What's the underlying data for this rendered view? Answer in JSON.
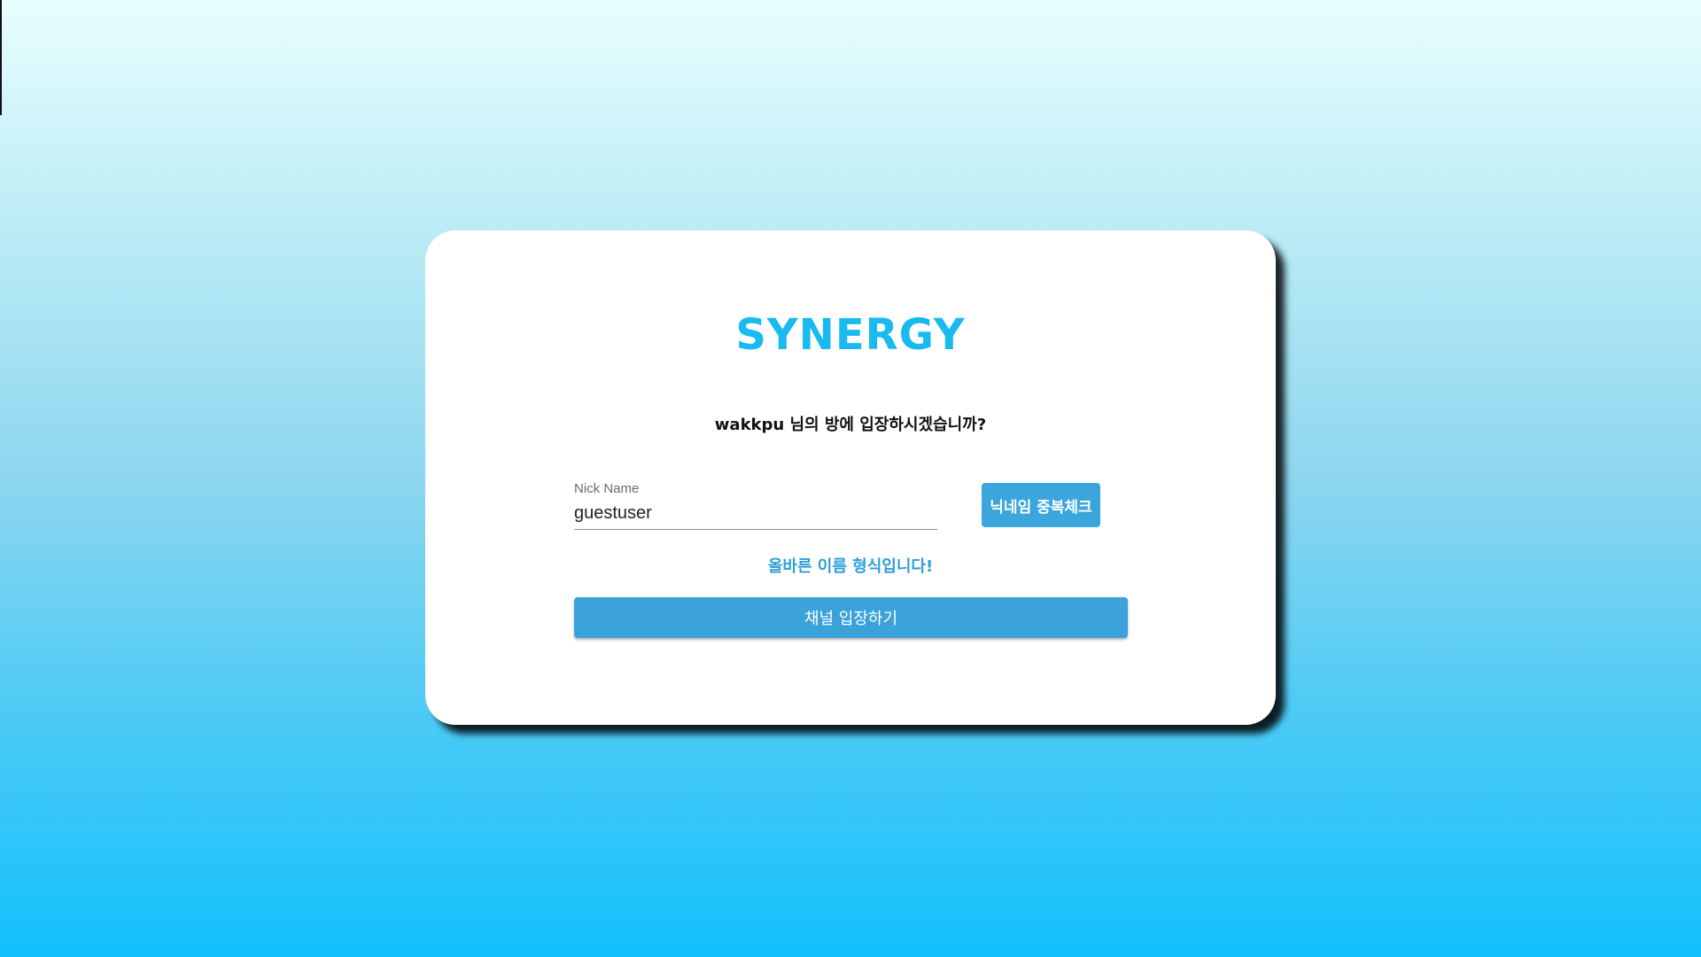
{
  "app": {
    "logo_text": "SYNERGY"
  },
  "room": {
    "prompt": "wakkpu 님의 방에 입장하시겠습니까?"
  },
  "nickname_field": {
    "label": "Nick Name",
    "value": "guestuser"
  },
  "buttons": {
    "duplicate_check_label": "닉네임 중복체크",
    "enter_channel_label": "채널 입장하기"
  },
  "validation": {
    "message": "올바른 이름 형식입니다!"
  },
  "colors": {
    "accent": "#19baf0",
    "button": "#3aa6dc",
    "validation_text": "#2e9fd8"
  }
}
